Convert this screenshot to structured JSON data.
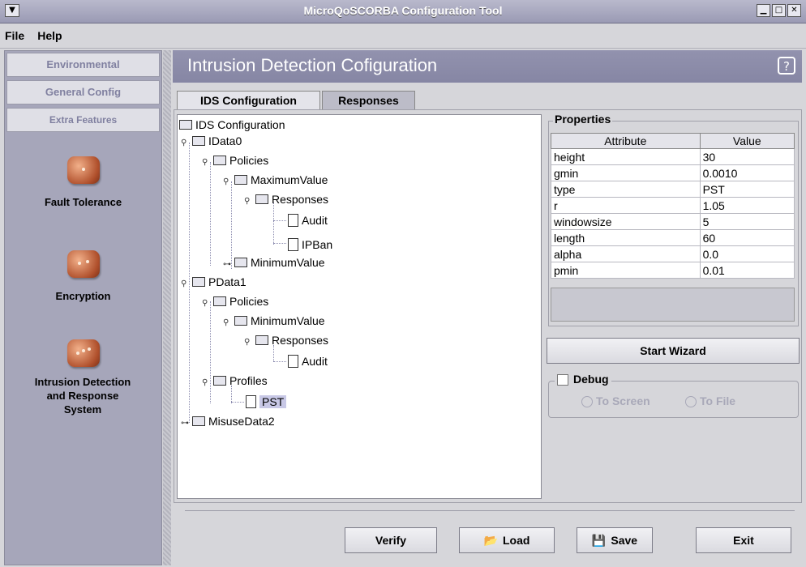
{
  "window": {
    "title": "MicroQoSCORBA Configuration Tool"
  },
  "menu": [
    "File",
    "Help"
  ],
  "sidebar": {
    "nav": [
      "Environmental",
      "General Config",
      "Extra Features"
    ],
    "features": [
      "Fault Tolerance",
      "Encryption",
      "Intrusion Detection and Response System"
    ]
  },
  "header": {
    "title": "Intrusion Detection Cofiguration",
    "help_icon": "?"
  },
  "tabs": [
    "IDS Configuration",
    "Responses"
  ],
  "tree": [
    {
      "label": "IDS Configuration",
      "type": "folder",
      "toggle": ""
    },
    {
      "label": "IData0",
      "type": "folder",
      "toggle": "expanded"
    },
    {
      "label": "Policies",
      "type": "folder",
      "toggle": "expanded"
    },
    {
      "label": "MaximumValue",
      "type": "folder",
      "toggle": "expanded"
    },
    {
      "label": "Responses",
      "type": "folder",
      "toggle": "expanded"
    },
    {
      "label": "Audit",
      "type": "file",
      "toggle": ""
    },
    {
      "label": "IPBan",
      "type": "file",
      "toggle": ""
    },
    {
      "label": "MinimumValue",
      "type": "folder",
      "toggle": "collapsed"
    },
    {
      "label": "PData1",
      "type": "folder",
      "toggle": "expanded"
    },
    {
      "label": "Policies",
      "type": "folder",
      "toggle": "expanded"
    },
    {
      "label": "MinimumValue",
      "type": "folder",
      "toggle": "expanded"
    },
    {
      "label": "Responses",
      "type": "folder",
      "toggle": "expanded"
    },
    {
      "label": "Audit",
      "type": "file",
      "toggle": ""
    },
    {
      "label": "Profiles",
      "type": "folder",
      "toggle": "expanded"
    },
    {
      "label": "PST",
      "type": "file",
      "toggle": "",
      "selected": true
    },
    {
      "label": "MisuseData2",
      "type": "folder",
      "toggle": "collapsed"
    }
  ],
  "properties": {
    "title": "Properties",
    "headers": [
      "Attribute",
      "Value"
    ],
    "rows": [
      [
        "height",
        "30"
      ],
      [
        "gmin",
        "0.0010"
      ],
      [
        "type",
        "PST"
      ],
      [
        "r",
        "1.05"
      ],
      [
        "windowsize",
        "5"
      ],
      [
        "length",
        "60"
      ],
      [
        "alpha",
        "0.0"
      ],
      [
        "pmin",
        "0.01"
      ]
    ]
  },
  "wizard": {
    "label": "Start Wizard"
  },
  "debug": {
    "label": "Debug",
    "checked": false,
    "options": [
      "To Screen",
      "To File"
    ]
  },
  "footer": {
    "buttons": [
      "Verify",
      "Load",
      "Save",
      "Exit"
    ]
  }
}
